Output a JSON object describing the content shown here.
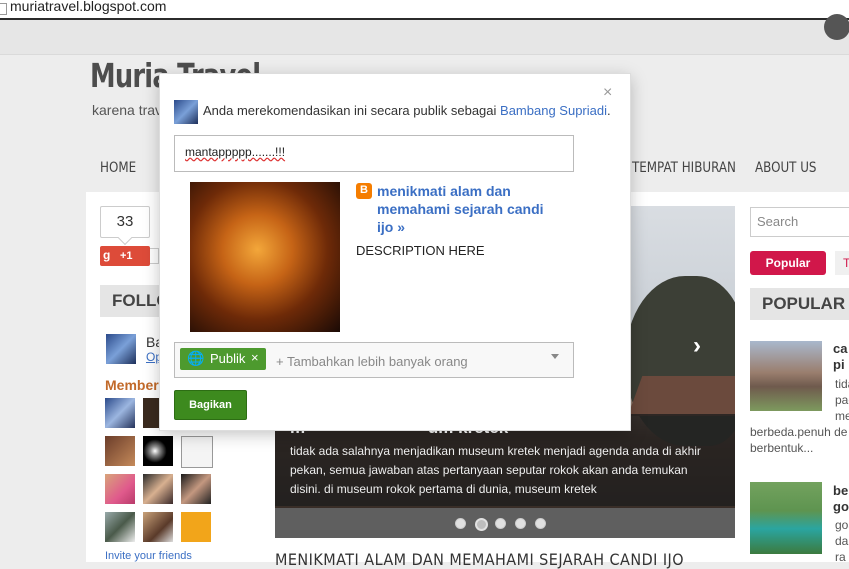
{
  "browser": {
    "url": "muriatravel.blogspot.com"
  },
  "blog": {
    "title": "Muria Travel",
    "tagline": "karena trav"
  },
  "nav": {
    "items": [
      "HOME",
      "TEMPAT HIBURAN",
      "ABOUT US"
    ]
  },
  "gplus": {
    "count": "33",
    "button_label": "+1",
    "g_glyph": "g"
  },
  "followers": {
    "heading": "FOLLO",
    "member_name": "Ba",
    "member_sub": "Op",
    "members_label": "Members",
    "invite": "Invite your friends"
  },
  "slider": {
    "title": "menikmati alam dan memahami sejarah di museum kretek",
    "title_visible": "m                          um kretek",
    "text": "tidak ada salahnya menjadikan museum kretek menjadi agenda anda di akhir pekan, semua jawaban atas pertanyaan seputar rokok akan anda temukan disini. di museum rokok pertama di dunia, museum kretek",
    "arrow": "›",
    "active_dot": 1,
    "dot_count": 5
  },
  "post": {
    "title": "MENIKMATI ALAM DAN MEMAHAMI SEJARAH CANDI IJO"
  },
  "sidebar": {
    "search_placeholder": "Search",
    "tabs": [
      "Popular",
      "T"
    ],
    "popular_heading": "POPULAR P",
    "item1": {
      "title_lines": [
        "ca",
        "pi"
      ],
      "text_lines": [
        "tida",
        "pac",
        "me"
      ],
      "trail": [
        "berbeda.penuh de",
        "berbentuk..."
      ]
    },
    "item2": {
      "title_lines": [
        "be",
        "go"
      ],
      "text_lines": [
        "goa",
        "dar",
        "ra"
      ]
    }
  },
  "dialog": {
    "notice": "Anda merekomendasikan ini secara publik sebagai",
    "user": "Bambang Supriadi",
    "notice_end": ".",
    "close": "×",
    "comment": "mantappppp.......!!!",
    "link_title": "menikmati alam dan memahami sejarah candi ijo »",
    "link_desc": "DESCRIPTION HERE",
    "blogger_glyph": "B",
    "audience_chip": "Publik",
    "audience_remove": "×",
    "add_people": "+ Tambahkan lebih banyak orang",
    "share_button": "Bagikan"
  },
  "colors": {
    "share_green": "#3d8a1e",
    "chip_green": "#4d9a2e",
    "link_blue": "#3b6fc4",
    "popular_red": "#d1174a",
    "gplus_red": "#dd4b39",
    "blogger_orange": "#f57d00"
  },
  "icons": [
    "page-icon",
    "blogger-icon",
    "globe-icon",
    "close-icon",
    "dropdown-caret-icon",
    "slider-next-icon"
  ]
}
